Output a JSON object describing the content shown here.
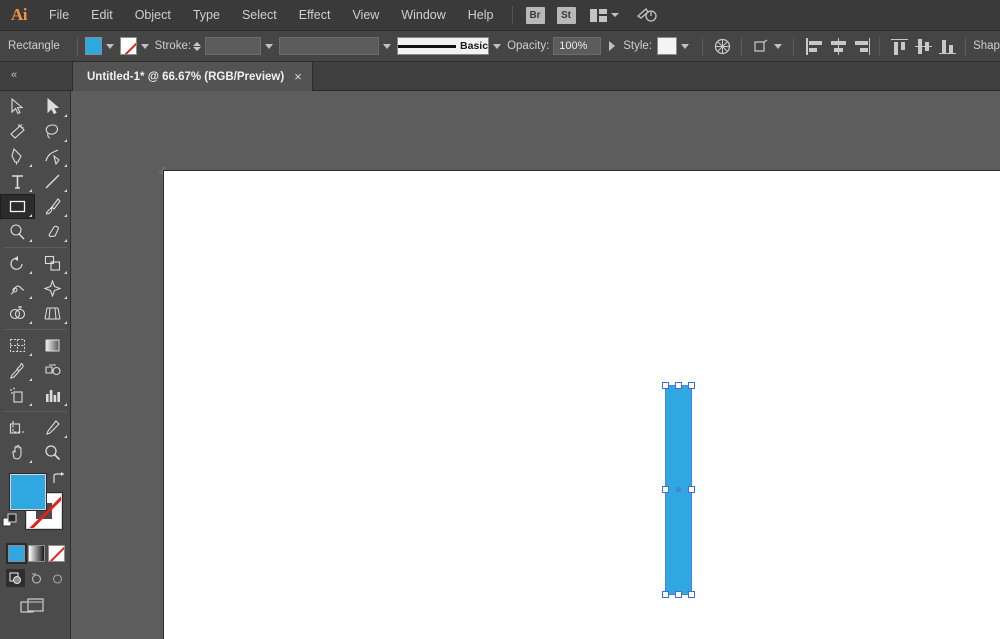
{
  "app": {
    "name": "Adobe Illustrator",
    "logo_text": "Ai",
    "accent_color": "#f29441",
    "menubar_bg": "#3a3a3a",
    "controlbar_bg": "#454545",
    "canvas_bg": "#5d5d5d",
    "toolpanel_bg": "#4b4b4b",
    "fill_color": "#2fa7e0",
    "selection_color": "#4d7fe8"
  },
  "menubar": {
    "items": [
      {
        "label": "File"
      },
      {
        "label": "Edit"
      },
      {
        "label": "Object"
      },
      {
        "label": "Type"
      },
      {
        "label": "Select"
      },
      {
        "label": "Effect"
      },
      {
        "label": "View"
      },
      {
        "label": "Window"
      },
      {
        "label": "Help"
      }
    ],
    "bridge_label": "Br",
    "stock_label": "St",
    "arrange_icon": "arrange-documents-icon",
    "workspace_icon": "workspace-switcher-icon"
  },
  "controlbar": {
    "object_type": "Rectangle",
    "fill_swatch": "fill-swatch",
    "fill_value": "#2fa7e0",
    "stroke_swatch": "stroke-swatch-none",
    "stroke_label": "Stroke:",
    "stroke_weight": "",
    "stroke_weight_placeholder": "",
    "variable_width": "",
    "stroke_profile": "Basic",
    "opacity_label": "Opacity:",
    "opacity_value": "100%",
    "style_label": "Style:",
    "style_swatch": "graphic-style-swatch",
    "recolor_icon": "recolor-artwork-icon",
    "transform_icon": "transform-icon",
    "align_icons": [
      "align-left-icon",
      "align-horizontal-center-icon",
      "align-right-icon",
      "align-top-icon",
      "align-vertical-center-icon",
      "align-bottom-icon"
    ],
    "shape_label": "Shap"
  },
  "tabbar": {
    "collapse_icon": "collapse-panel-icon",
    "document_title": "Untitled-1* @ 66.67% (RGB/Preview)",
    "close_label": "×"
  },
  "toolbar": {
    "tools": [
      {
        "name": "selection-tool",
        "row": 0,
        "col": 0,
        "active": false
      },
      {
        "name": "direct-selection-tool",
        "row": 0,
        "col": 1,
        "active": false
      },
      {
        "name": "magic-wand-tool",
        "row": 1,
        "col": 0,
        "active": false
      },
      {
        "name": "lasso-tool",
        "row": 1,
        "col": 1,
        "active": false
      },
      {
        "name": "pen-tool",
        "row": 2,
        "col": 0,
        "active": false
      },
      {
        "name": "curvature-tool",
        "row": 2,
        "col": 1,
        "active": false
      },
      {
        "name": "type-tool",
        "row": 3,
        "col": 0,
        "active": false
      },
      {
        "name": "line-segment-tool",
        "row": 3,
        "col": 1,
        "active": false
      },
      {
        "name": "rectangle-tool",
        "row": 4,
        "col": 0,
        "active": true
      },
      {
        "name": "paintbrush-tool",
        "row": 4,
        "col": 1,
        "active": false
      },
      {
        "name": "shaper-tool",
        "row": 5,
        "col": 0,
        "active": false
      },
      {
        "name": "eraser-tool",
        "row": 5,
        "col": 1,
        "active": false
      },
      {
        "name": "rotate-tool",
        "row": 6,
        "col": 0,
        "active": false
      },
      {
        "name": "scale-tool",
        "row": 6,
        "col": 1,
        "active": false
      },
      {
        "name": "width-tool",
        "row": 7,
        "col": 0,
        "active": false
      },
      {
        "name": "free-transform-tool",
        "row": 7,
        "col": 1,
        "active": false
      },
      {
        "name": "shape-builder-tool",
        "row": 8,
        "col": 0,
        "active": false
      },
      {
        "name": "perspective-grid-tool",
        "row": 8,
        "col": 1,
        "active": false
      },
      {
        "name": "mesh-tool",
        "row": 9,
        "col": 0,
        "active": false
      },
      {
        "name": "gradient-tool",
        "row": 9,
        "col": 1,
        "active": false
      },
      {
        "name": "eyedropper-tool",
        "row": 10,
        "col": 0,
        "active": false
      },
      {
        "name": "blend-tool",
        "row": 10,
        "col": 1,
        "active": false
      },
      {
        "name": "symbol-sprayer-tool",
        "row": 11,
        "col": 0,
        "active": false
      },
      {
        "name": "column-graph-tool",
        "row": 11,
        "col": 1,
        "active": false
      },
      {
        "name": "artboard-tool",
        "row": 12,
        "col": 0,
        "active": false
      },
      {
        "name": "slice-tool",
        "row": 12,
        "col": 1,
        "active": false
      },
      {
        "name": "hand-tool",
        "row": 13,
        "col": 0,
        "active": false
      },
      {
        "name": "zoom-tool",
        "row": 13,
        "col": 1,
        "active": false
      }
    ],
    "fill_color": "#2fa7e0",
    "stroke_color": "none",
    "swap_icon": "swap-fill-stroke-icon",
    "default_icon": "default-fill-stroke-icon",
    "color_modes": [
      {
        "name": "color-button",
        "selected": true
      },
      {
        "name": "gradient-button",
        "selected": false
      },
      {
        "name": "none-button",
        "selected": false
      }
    ],
    "screen_modes": [
      {
        "name": "drawing-normal-button",
        "selected": true
      },
      {
        "name": "drawing-behind-button",
        "selected": false
      },
      {
        "name": "drawing-inside-button",
        "selected": false
      }
    ],
    "change_screen_mode": "change-screen-mode-icon"
  },
  "canvas": {
    "artboard_name": "artboard",
    "selected_object": {
      "name": "rectangle-shape",
      "fill": "#2fa7e0",
      "handle_count": 8,
      "has_center_point": true
    }
  }
}
